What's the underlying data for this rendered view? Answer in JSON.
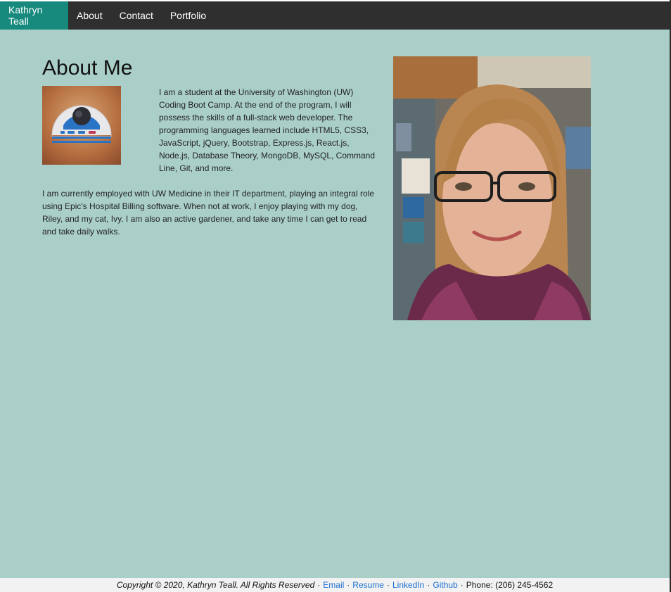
{
  "nav": {
    "brand": "Kathryn Teall",
    "links": [
      "About",
      "Contact",
      "Portfolio"
    ]
  },
  "about": {
    "title": "About Me",
    "para1": "I am a student at the University of Washington (UW) Coding Boot Camp. At the end of the program, I will possess the skills of a full-stack web developer. The programming languages learned include HTML5, CSS3, JavaScript, jQuery, Bootstrap, Express.js, React.js, Node.js, Database Theory, MongoDB, MySQL, Command Line, Git, and more.",
    "para2": "I am currently employed with UW Medicine in their IT department, playing an integral role using Epic's Hospital Billing software. When not at work, I enjoy playing with my dog, Riley, and my cat, Ivy. I am also an active gardener, and take any time I can get to read and take daily walks."
  },
  "footer": {
    "copyright": "Copyright © 2020, Kathryn Teall. All Rights Reserved",
    "links": [
      "Email",
      "Resume",
      "LinkedIn",
      "Github"
    ],
    "phone": "Phone: (206) 245-4562",
    "separator": "·"
  },
  "colors": {
    "background": "#aacfc8",
    "navbar": "#2f2f2f",
    "brand": "#178a7d",
    "link": "#1a6fd1"
  },
  "images": {
    "icon": "robot-dome-icon",
    "photo": "profile-photo"
  }
}
